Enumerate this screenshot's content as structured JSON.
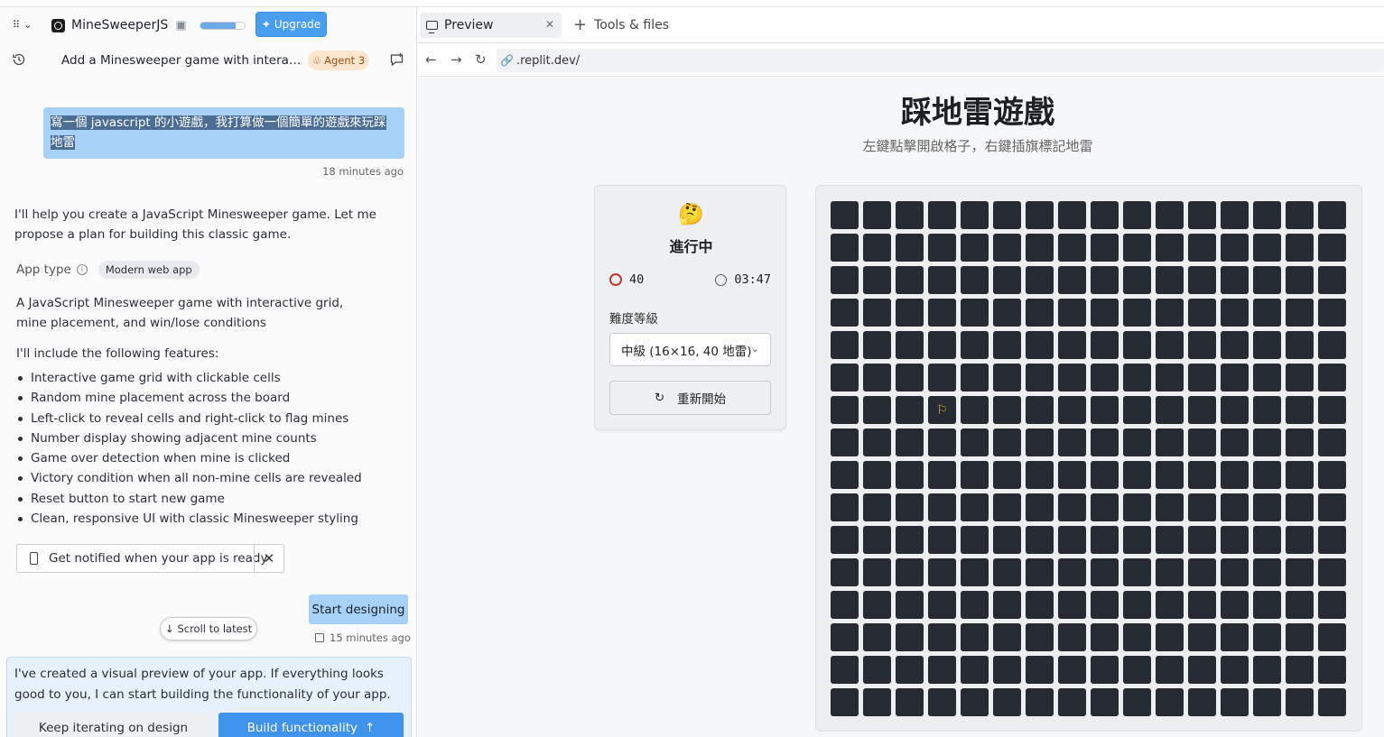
{
  "header": {
    "app_name": "MineSweeperJS",
    "progress": 0.8,
    "upgrade_label": "Upgrade",
    "thread_title": "Add a Minesweeper game with interactiv...",
    "agent_badge": "Agent 3"
  },
  "chat": {
    "user_message": "寫一個 javascript 的小遊戲，我打算做一個簡單的遊戲來玩踩地雷",
    "user_time": "18 minutes ago",
    "assistant_intro": "I'll help you create a JavaScript Minesweeper game. Let me propose a plan for building this classic game.",
    "app_type_label": "App type",
    "app_type_value": "Modern web app",
    "description": "A JavaScript Minesweeper game with interactive grid, mine placement, and win/lose conditions",
    "features_intro": "I'll include the following features:",
    "features": [
      "Interactive game grid with clickable cells",
      "Random mine placement across the board",
      "Left-click to reveal cells and right-click to flag mines",
      "Number display showing adjacent mine counts",
      "Game over detection when mine is clicked",
      "Victory condition when all non-mine cells are revealed",
      "Reset button to start new game",
      "Clean, responsive UI with classic Minesweeper styling"
    ],
    "notify_label": "Get notified when your app is ready",
    "notify_close": "✕",
    "start_designing": "Start designing",
    "scroll_latest": "Scroll to latest",
    "start_time": "15 minutes ago",
    "agent_card_text": "I've created a visual preview of your app. If everything looks good to you, I can start building the functionality of your app.",
    "keep_iterating": "Keep iterating on design",
    "build_functionality": "Build functionality"
  },
  "tabs": {
    "preview": "Preview",
    "tools": "Tools & files"
  },
  "browser": {
    "url": ".replit.dev/"
  },
  "game": {
    "title": "踩地雷遊戲",
    "subtitle": "左鍵點擊開啟格子，右鍵插旗標記地雷",
    "face": "🤔",
    "state": "進行中",
    "mines": "40",
    "timer": "03:47",
    "difficulty_label": "難度等級",
    "difficulty_value": "中級 (16×16, 40 地雷)",
    "restart": "重新開始",
    "rows": 16,
    "cols": 16,
    "flagged_cells": [
      {
        "row": 7,
        "col": 4
      }
    ],
    "cell_color": "#262b33",
    "flag_color": "#e6b325"
  }
}
